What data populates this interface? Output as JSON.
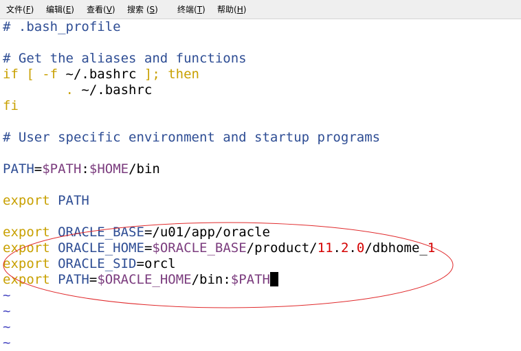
{
  "menubar": {
    "file": {
      "label": "文件(",
      "mnemonic": "F",
      "tail": ")"
    },
    "edit": {
      "label": "编辑(",
      "mnemonic": "E",
      "tail": ")"
    },
    "view": {
      "label": "查看(",
      "mnemonic": "V",
      "tail": ")"
    },
    "search": {
      "label": "搜索 (",
      "mnemonic": "S",
      "tail": ")"
    },
    "terminal": {
      "label": "终端(",
      "mnemonic": "T",
      "tail": ")"
    },
    "help": {
      "label": "帮助(",
      "mnemonic": "H",
      "tail": ")"
    }
  },
  "editor": {
    "line1": {
      "comment": "# .bash_profile"
    },
    "line3": {
      "comment": "# Get the aliases and functions"
    },
    "line4": {
      "kw1": "if [ -f ",
      "path": "~/.bashrc",
      "kw2": " ]; then"
    },
    "line5": {
      "indent": "        ",
      "dot": ".",
      "path": " ~/.bashrc"
    },
    "line6": {
      "kw": "fi"
    },
    "line8": {
      "comment": "# User specific environment and startup programs"
    },
    "line10": {
      "id": "PATH",
      "eq": "=",
      "v1": "$PATH",
      "colon": ":",
      "v2": "$HOME",
      "rest": "/bin"
    },
    "line12": {
      "kw": "export",
      "sp": " ",
      "id": "PATH"
    },
    "line14": {
      "kw": "export",
      "sp": " ",
      "id": "ORACLE_BASE",
      "eq": "=",
      "val": "/u01/app/oracle"
    },
    "line15": {
      "kw": "export",
      "sp": " ",
      "id": "ORACLE_HOME",
      "eq": "=",
      "v": "$ORACLE_BASE",
      "p1": "/product/",
      "n1": "11",
      "d1": ".",
      "n2": "2",
      "d2": ".",
      "n3": "0",
      "p2": "/dbhome_",
      "n4": "1"
    },
    "line16": {
      "kw": "export",
      "sp": " ",
      "id": "ORACLE_SID",
      "eq": "=",
      "val": "orcl"
    },
    "line17": {
      "kw": "export",
      "sp": " ",
      "id": "PATH",
      "eq": "=",
      "v1": "$ORACLE_HOME",
      "p1": "/bin:",
      "v2": "$PATH"
    },
    "tilde": "~"
  },
  "colors": {
    "comment": "#2e4d94",
    "keyword": "#c8a000",
    "variable": "#7b3c7e",
    "number": "#d40000",
    "annotation": "#e0282a"
  }
}
